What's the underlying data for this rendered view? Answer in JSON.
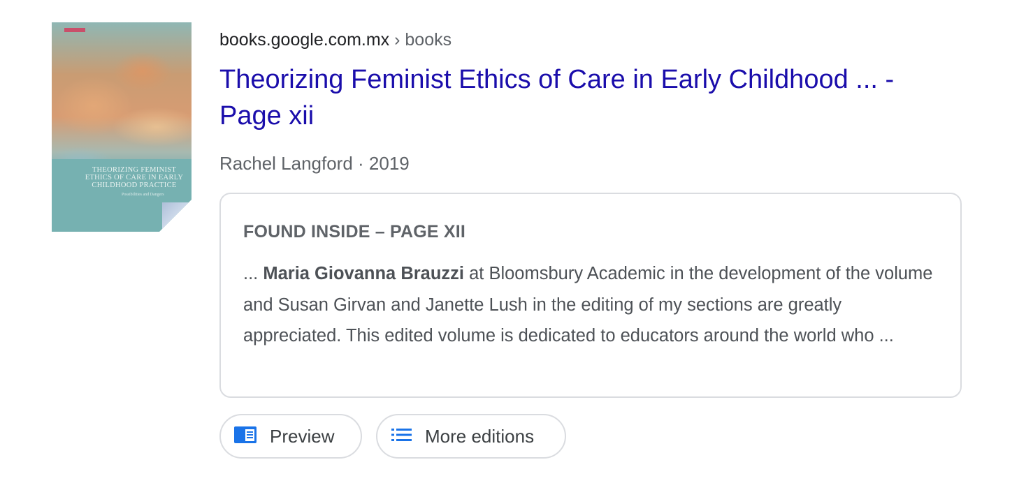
{
  "result": {
    "breadcrumb": {
      "domain": "books.google.com.mx",
      "separator": " › ",
      "path": "books"
    },
    "title": "Theorizing Feminist Ethics of Care in Early Childhood ... - Page xii",
    "byline": "Rachel Langford · 2019",
    "cover": {
      "title": "Theorizing Feminist Ethics of Care in Early Childhood Practice",
      "subtitle": "Possibilities and Dangers",
      "colors": {
        "teal": "#76b1b1",
        "orange": "#d79c73"
      }
    },
    "snippet": {
      "label": "FOUND INSIDE – PAGE XII",
      "prefix": "... ",
      "bold": "Maria Giovanna Brauzzi",
      "rest": " at Bloomsbury Academic in the development of the volume and Susan Girvan and Janette Lush in the editing of my sections are greatly appreciated. This edited volume is dedicated to educators around the world who ..."
    },
    "actions": [
      {
        "label": "Preview",
        "icon": "book-icon"
      },
      {
        "label": "More editions",
        "icon": "list-icon"
      }
    ]
  },
  "colors": {
    "link": "#1a0dab",
    "icon_blue": "#1a73e8",
    "border": "#dadce0",
    "muted": "#5f6368"
  }
}
